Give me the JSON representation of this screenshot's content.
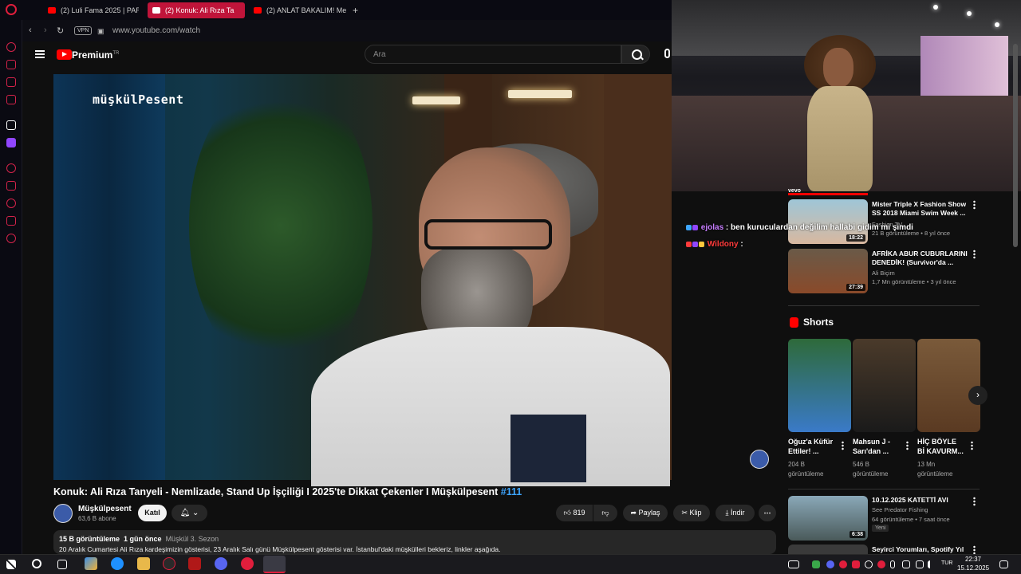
{
  "browser": {
    "tabs": [
      {
        "label": "(2) Luli Fama 2025 | PARA"
      },
      {
        "label": "(2) Konuk: Ali Rıza Ta"
      },
      {
        "label": "(2) ANLAT BAKALIM! Me"
      }
    ],
    "new_tab": "+",
    "url": "www.youtube.com/watch",
    "vpn": "VPN"
  },
  "youtube": {
    "brand": "Premium",
    "brand_sup": "TR",
    "search_placeholder": "Ara"
  },
  "video": {
    "watermark": "müşkülPesent",
    "title": "Konuk: Ali Rıza Tanyeli - Nemlizade, Stand Up İşçiliği I 2025'te Dikkat Çekenler I Müşkülpesent",
    "hashtag": "#111",
    "channel": "Müşkülpesent",
    "subscribers": "63,6 B abone",
    "join": "Katıl",
    "likes": "819",
    "share": "Paylaş",
    "clip": "Klip",
    "download": "İndir",
    "views": "15 B görüntüleme",
    "age": "1 gün önce",
    "season": "Müşkül 3. Sezon",
    "description": "20 Aralık Cumartesi Ali Rıza kardeşimizin gösterisi, 23 Aralık Salı günü Müşkülpesent gösterisi var. İstanbul'daki müşkülleri bekleriz, linkler aşağıda."
  },
  "chat": [
    {
      "user": "ejolas",
      "message": ": ben kuruculardan değilim hallabi gidim mi şimdi"
    },
    {
      "user": "Wildony",
      "message": ":"
    }
  ],
  "recommendations": [
    {
      "title": "Mister Triple X Fashion Show SS 2018 Miami Swim Week ...",
      "channel": "Fashion TV",
      "meta": "21 B görüntüleme • 8 yıl önce",
      "duration": "18:22"
    },
    {
      "title": "AFRİKA ABUR CUBURLARINI DENEDİK! (Survivor'da ...",
      "channel": "Ali Biçim",
      "meta": "1,7 Mn görüntüleme • 3 yıl önce",
      "duration": "27:39"
    },
    {
      "title": "10.12.2025 KATETTİ AVI",
      "channel": "See Predator Fishing",
      "meta": "64 görüntüleme • 7 saat önce",
      "duration": "6:38",
      "badge": "Yeni"
    },
    {
      "title": "Seyirci Yorumları, Spotify Yıl",
      "channel": "",
      "meta": "",
      "duration": ""
    }
  ],
  "vevo_label": "vevo",
  "shorts": {
    "label": "Shorts",
    "items": [
      {
        "title": "Oğuz'a Küfür Ettiler! ...",
        "views": "204 B görüntüleme"
      },
      {
        "title": "Mahsun J - Sarı'dan ...",
        "views": "546 B görüntüleme"
      },
      {
        "title": "HİÇ BÖYLE Bİ KAVURM...",
        "views": "13 Mn görüntüleme"
      }
    ]
  },
  "taskbar": {
    "time": "22:37",
    "date": "15.12.2025",
    "lang": "TUR"
  },
  "colors": {
    "accent": "#ff0000",
    "opera": "#e01e3c",
    "link": "#3ea6ff"
  }
}
